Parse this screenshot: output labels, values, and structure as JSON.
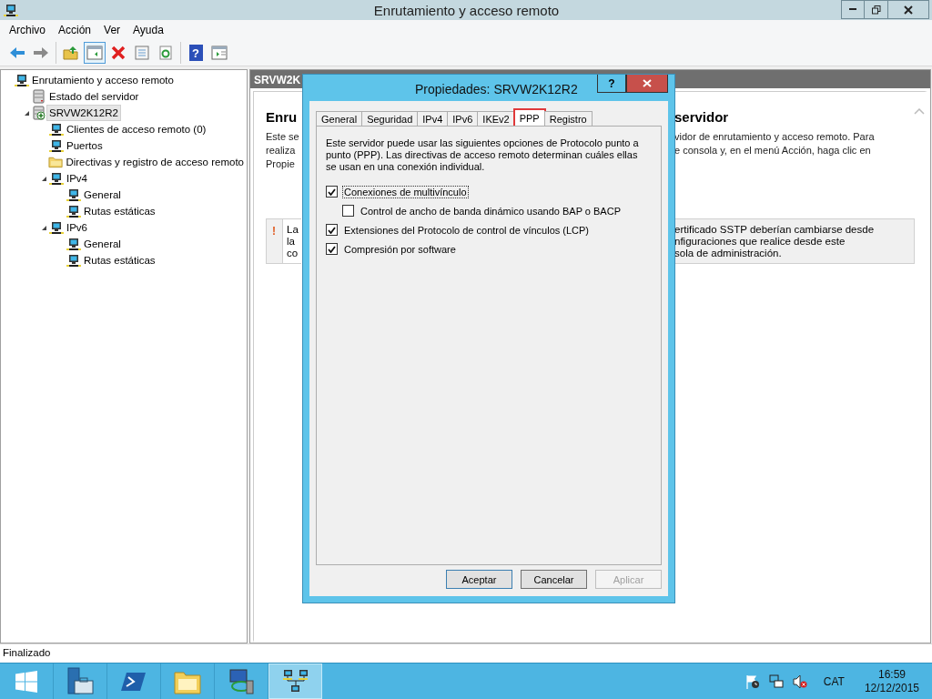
{
  "window": {
    "title": "Enrutamiento y acceso remoto"
  },
  "menu": [
    "Archivo",
    "Acción",
    "Ver",
    "Ayuda"
  ],
  "toolbar": {
    "groups": [
      {
        "items": [
          {
            "kind": "back",
            "pressed": false
          },
          {
            "kind": "forward",
            "pressed": false
          }
        ]
      },
      {
        "items": [
          {
            "kind": "up",
            "pressed": false
          },
          {
            "kind": "tree",
            "pressed": true
          },
          {
            "kind": "delete",
            "pressed": false
          },
          {
            "kind": "properties",
            "pressed": false
          },
          {
            "kind": "refresh",
            "pressed": false
          }
        ]
      },
      {
        "items": [
          {
            "kind": "help",
            "pressed": false,
            "glyph": "?"
          },
          {
            "kind": "pane",
            "pressed": false
          }
        ]
      }
    ]
  },
  "tree": [
    {
      "label": "Enrutamiento y acceso remoto",
      "kind": "network",
      "selected": false,
      "children": [
        {
          "label": "Estado del servidor",
          "kind": "server",
          "selected": false
        },
        {
          "label": "SRVW2K12R2",
          "kind": "server-add",
          "selected": true,
          "expanded": true,
          "children": [
            {
              "label": "Clientes de acceso remoto (0)",
              "kind": "network",
              "selected": false
            },
            {
              "label": "Puertos",
              "kind": "network",
              "selected": false
            },
            {
              "label": "Directivas y registro de acceso remoto",
              "kind": "folder",
              "selected": false
            },
            {
              "label": "IPv4",
              "kind": "network",
              "selected": false,
              "expanded": true,
              "children": [
                {
                  "label": "General",
                  "kind": "network",
                  "selected": false
                },
                {
                  "label": "Rutas estáticas",
                  "kind": "network",
                  "selected": false
                }
              ]
            },
            {
              "label": "IPv6",
              "kind": "network",
              "selected": false,
              "expanded": true,
              "children": [
                {
                  "label": "General",
                  "kind": "network",
                  "selected": false
                },
                {
                  "label": "Rutas estáticas",
                  "kind": "network",
                  "selected": false
                }
              ]
            }
          ]
        }
      ]
    }
  ],
  "panel": {
    "header": "SRVW2K",
    "heading": {
      "left": "Enru",
      "right": "servidor"
    },
    "paragraph": [
      {
        "left": "Este se",
        "right": "vidor de enrutamiento y acceso remoto. Para"
      },
      {
        "left": "realiza",
        "right": "e consola y, en el menú Acción, haga clic en"
      },
      {
        "left": "Propie"
      }
    ],
    "warning": {
      "mark": "!",
      "lines": [
        {
          "left": "La",
          "right": "ertificado SSTP deberían cambiarse desde"
        },
        {
          "left": "la",
          "right": "nfiguraciones que realice desde este"
        },
        {
          "left": "co",
          "right": "sola de administración."
        }
      ]
    }
  },
  "dialog": {
    "title": "Propiedades: SRVW2K12R2",
    "help": "?",
    "tabs": [
      {
        "label": "General",
        "selected": false,
        "highlighted": false
      },
      {
        "label": "Seguridad",
        "selected": false,
        "highlighted": false
      },
      {
        "label": "IPv4",
        "selected": false,
        "highlighted": false
      },
      {
        "label": "IPv6",
        "selected": false,
        "highlighted": false
      },
      {
        "label": "IKEv2",
        "selected": false,
        "highlighted": false
      },
      {
        "label": "PPP",
        "selected": true,
        "highlighted": true
      },
      {
        "label": "Registro",
        "selected": false,
        "highlighted": false
      }
    ],
    "description": "Este servidor puede usar las siguientes opciones de Protocolo punto a punto (PPP). Las directivas de acceso remoto determinan cuáles ellas se usan en una conexión individual.",
    "options": [
      {
        "label": "Conexiones de multivínculo",
        "checked": true,
        "focused": true,
        "children": [
          {
            "label": "Control de ancho de banda dinámico usando BAP o BACP",
            "checked": false,
            "focused": false
          }
        ]
      },
      {
        "label": "Extensiones del Protocolo de control de vínculos (LCP)",
        "checked": true,
        "focused": false
      },
      {
        "label": "Compresión por software",
        "checked": true,
        "focused": false
      }
    ],
    "buttons": [
      {
        "label": "Aceptar",
        "default": true,
        "disabled": false
      },
      {
        "label": "Cancelar",
        "default": false,
        "disabled": false
      },
      {
        "label": "Aplicar",
        "default": false,
        "disabled": true
      }
    ]
  },
  "status_bar": "Finalizado",
  "taskbar": {
    "apps": [
      {
        "kind": "start",
        "active": false
      },
      {
        "kind": "server-manager",
        "active": false
      },
      {
        "kind": "powershell",
        "active": false
      },
      {
        "kind": "explorer",
        "active": false
      },
      {
        "kind": "network-settings",
        "active": false
      },
      {
        "kind": "routing",
        "active": true
      }
    ],
    "tray": [
      {
        "kind": "flag"
      },
      {
        "kind": "network"
      },
      {
        "kind": "speaker-muted"
      }
    ],
    "language": "CAT",
    "time": "16:59",
    "date": "12/12/2015"
  }
}
